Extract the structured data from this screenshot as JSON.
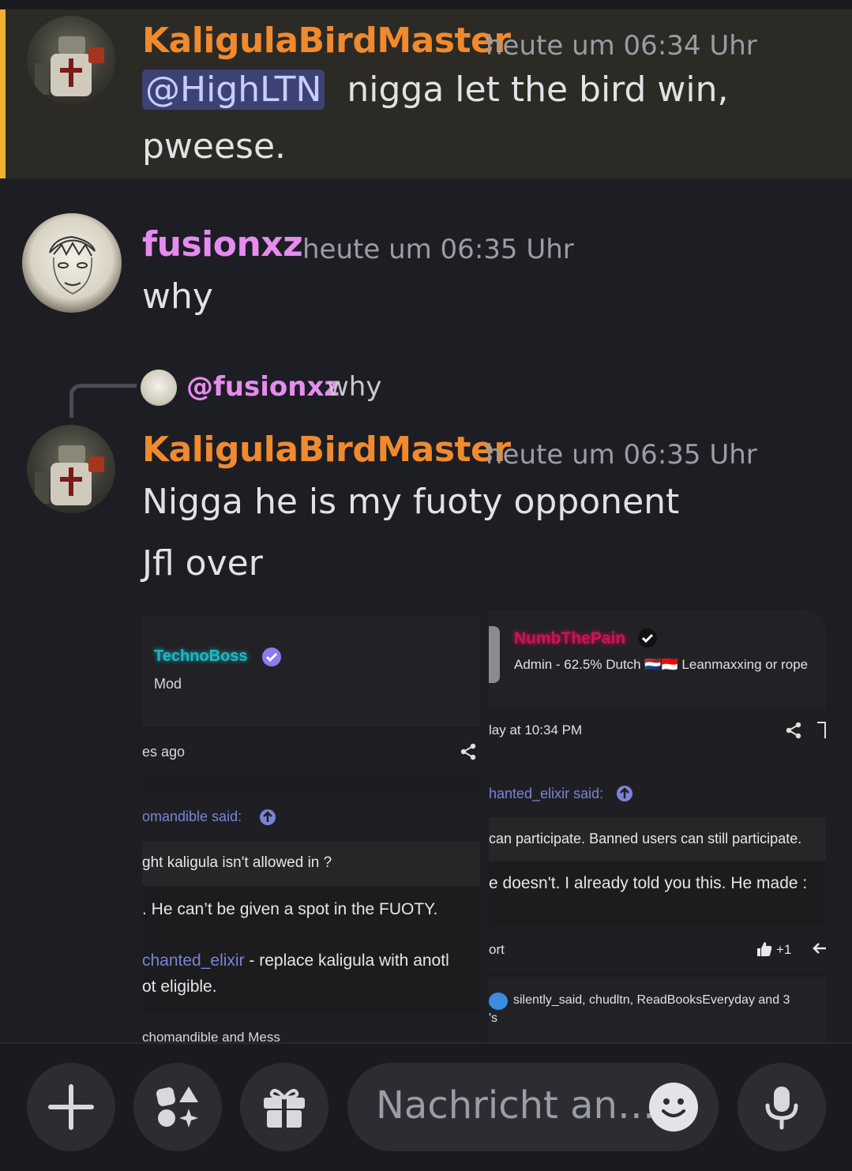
{
  "messages": {
    "m1": {
      "author": "KaligulaBirdMaster",
      "timestamp": "heute um 06:34 Uhr",
      "mention": "@HighLTN",
      "text_line1": "nigga let the bird win,",
      "text_line2": "pweese."
    },
    "m2": {
      "author": "fusionxz",
      "timestamp": "heute um 06:35 Uhr",
      "text": "why"
    },
    "m3": {
      "reply_to_mention": "@fusionxz",
      "reply_to_text": "why",
      "author": "KaligulaBirdMaster",
      "timestamp": "heute um 06:35 Uhr",
      "text_line1": "Nigga he is my fuoty opponent",
      "text_line2": "Jfl over"
    }
  },
  "attachment_left": {
    "username": "TechnoBoss",
    "role": "Mod",
    "time": "es ago",
    "quote_header": "omandible said:",
    "quote_text": "ght kaligula isn't allowed in ?",
    "body_line1": ". He can’t be given a spot in the FUOTY.",
    "mention_user": "chanted_elixir",
    "body_line2_rest": " - replace kaligula with anotl",
    "body_line3": "ot eligible.",
    "reactions": "chomandible and Mess"
  },
  "attachment_right": {
    "username": "NumbThePain",
    "subtitle": "Admin - 62.5% Dutch 🇳🇱🇮🇩 Leanmaxxing or rope",
    "time": "lay at 10:34 PM",
    "quote_header": "hanted_elixir said:",
    "quote_text": "can participate. Banned users can still participate.",
    "body_line1": "e doesn't. I already told you this. He made :",
    "report": "ort",
    "reaction_count": "+1",
    "reactions_line1": "silently_said, chudltn, ReadBooksEveryday and 3",
    "reactions_line2": "'s"
  },
  "composer": {
    "placeholder": "Nachricht an…"
  },
  "colors": {
    "accent_orange": "#f08a2e",
    "mention_pink": "#e68bf0",
    "highlight_bar": "#f0b132",
    "technoboss": "#1fb8c4",
    "numbthepain": "#d0105a"
  }
}
